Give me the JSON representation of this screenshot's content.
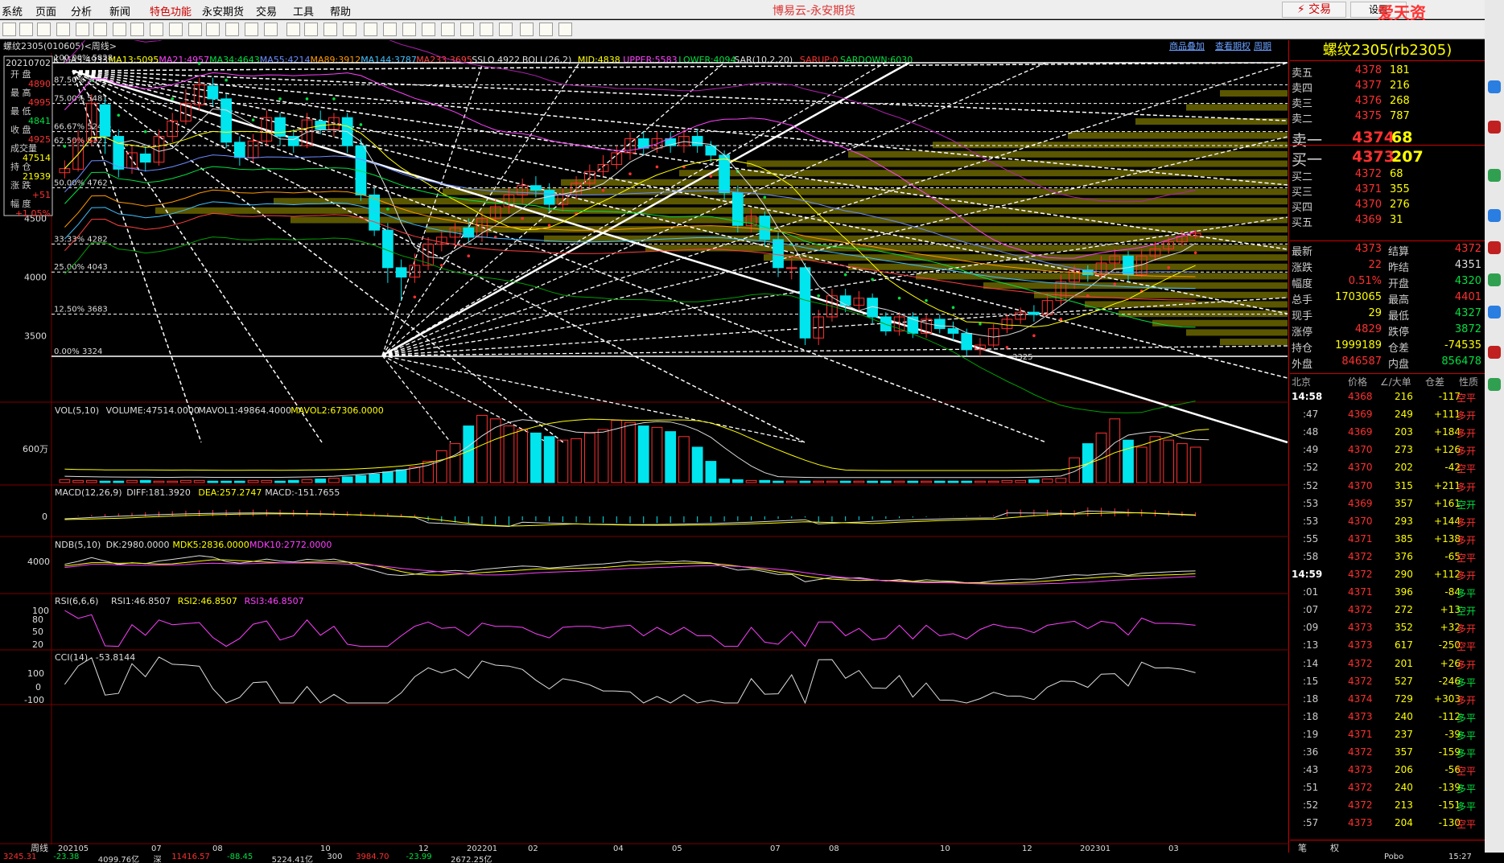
{
  "menu": [
    "系统",
    "页面",
    "分析",
    "新闻",
    "特色功能",
    "永安期货",
    "交易",
    "工具",
    "帮助"
  ],
  "app_title": "博易云-永安期货",
  "trade_button": "交易",
  "button2": "设置",
  "watermark": "爱天资5etz.com",
  "chart": {
    "instrument": "螺纹2305(010605)<周线>",
    "links": [
      "商品叠加",
      "查看期权",
      "周期"
    ],
    "ma_line": [
      {
        "t": "K",
        "c": "#ddd"
      },
      {
        "t": "MA5:4933",
        "c": "#ddd"
      },
      {
        "t": "MA13:5095",
        "c": "#ffff00"
      },
      {
        "t": "MA21:4957",
        "c": "#ff40ff"
      },
      {
        "t": "MA34:4643",
        "c": "#00e040"
      },
      {
        "t": "MA55:4214",
        "c": "#6a8cff"
      },
      {
        "t": "MA89:3912",
        "c": "#ff9900"
      },
      {
        "t": "MA144:3787",
        "c": "#40c0ff"
      },
      {
        "t": "MA233:3695",
        "c": "#ff4040"
      },
      {
        "t": "SSLO 4922",
        "c": "#ddd"
      },
      {
        "t": "BOLL(26,2)",
        "c": "#ddd"
      },
      {
        "t": "MID:4838",
        "c": "#ffff00"
      },
      {
        "t": "UPPER:5583",
        "c": "#ff40ff"
      },
      {
        "t": "LOWER:4094",
        "c": "#00e040"
      },
      {
        "t": "SAR(10,2,20)",
        "c": "#ddd"
      },
      {
        "t": "SARUP:0",
        "c": "#ff3030"
      },
      {
        "t": "SARDOWN:6030",
        "c": "#00e040"
      }
    ],
    "info_box": {
      "date": "20210702",
      "items": [
        {
          "label": "开 盘",
          "value": "4890",
          "color": "#ff3030"
        },
        {
          "label": "最 高",
          "value": "4995",
          "color": "#ff3030"
        },
        {
          "label": "最 低",
          "value": "4841",
          "color": "#00e040"
        },
        {
          "label": "收 盘",
          "value": "4925",
          "color": "#ff3030"
        },
        {
          "label": "成交量",
          "value": "47514",
          "color": "#ffff00"
        },
        {
          "label": "持 仓",
          "value": "21939",
          "color": "#ffff00"
        },
        {
          "label": "涨 跌",
          "value": "+51",
          "color": "#ff3030"
        },
        {
          "label": "幅 度",
          "value": "+1.05%",
          "color": "#ff3030"
        }
      ]
    },
    "yticks": [
      {
        "label": "4500",
        "y": 4500
      },
      {
        "label": "4000",
        "y": 4000
      },
      {
        "label": "3500",
        "y": 3500
      }
    ],
    "fib_levels": [
      {
        "pct": "100.00%",
        "val": "5828",
        "y": 5828
      },
      {
        "pct": "87.50%",
        "val": "5640",
        "y": 5640
      },
      {
        "pct": "75.00%",
        "val": "5481",
        "y": 5481
      },
      {
        "pct": "66.67%",
        "val": "5241",
        "y": 5241
      },
      {
        "pct": "62.50%",
        "val": "5121",
        "y": 5121
      },
      {
        "pct": "50.00%",
        "val": "4762",
        "y": 4762
      },
      {
        "pct": "33.33%",
        "val": "4282",
        "y": 4282
      },
      {
        "pct": "25.00%",
        "val": "4043",
        "y": 4043
      },
      {
        "pct": "12.50%",
        "val": "3683",
        "y": 3683
      },
      {
        "pct": "0.00%",
        "val": "3324",
        "y": 3324
      }
    ],
    "low_label": "3325",
    "xticks": [
      "202105",
      "07",
      "08",
      "10",
      "12",
      "202201",
      "02",
      "04",
      "05",
      "07",
      "08",
      "10",
      "12",
      "202301",
      "03"
    ],
    "period_label": "周线",
    "vol": {
      "title": "VOL(5,10)",
      "items": [
        {
          "t": "VOLUME:47514.0000",
          "c": "#ddd"
        },
        {
          "t": "MAVOL1:49864.4000",
          "c": "#ddd"
        },
        {
          "t": "MAVOL2:67306.0000",
          "c": "#ffff00"
        }
      ],
      "ytick": "600万"
    },
    "macd": {
      "title": "MACD(12,26,9)",
      "items": [
        {
          "t": "DIFF:181.3920",
          "c": "#ddd"
        },
        {
          "t": "DEA:257.2747",
          "c": "#ffff00"
        },
        {
          "t": "MACD:-151.7655",
          "c": "#ddd"
        }
      ],
      "ytick": "0"
    },
    "ndb": {
      "title": "NDB(5,10)",
      "items": [
        {
          "t": "DK:2980.0000",
          "c": "#ddd"
        },
        {
          "t": "MDK5:2836.0000",
          "c": "#ffff00"
        },
        {
          "t": "MDK10:2772.0000",
          "c": "#ff40ff"
        }
      ],
      "ytick": "4000"
    },
    "rsi": {
      "title": "RSI(6,6,6)",
      "items": [
        {
          "t": "RSI1:46.8507",
          "c": "#ddd"
        },
        {
          "t": "RSI2:46.8507",
          "c": "#ffff00"
        },
        {
          "t": "RSI3:46.8507",
          "c": "#ff40ff"
        }
      ],
      "yticks": [
        "100",
        "80",
        "50",
        "20"
      ]
    },
    "cci": {
      "title": "CCI(14)",
      "items": [
        {
          "t": "-53.8144",
          "c": "#ddd"
        }
      ],
      "yticks": [
        "100",
        "0",
        "-100"
      ]
    }
  },
  "quote": {
    "title": "螺纹2305(rb2305)",
    "asks": [
      {
        "label": "卖五",
        "price": "4378",
        "vol": "181"
      },
      {
        "label": "卖四",
        "price": "4377",
        "vol": "216"
      },
      {
        "label": "卖三",
        "price": "4376",
        "vol": "268"
      },
      {
        "label": "卖二",
        "price": "4375",
        "vol": "787"
      },
      {
        "label": "卖一",
        "price": "4374",
        "vol": "68"
      }
    ],
    "bids": [
      {
        "label": "买一",
        "price": "4373",
        "vol": "207"
      },
      {
        "label": "买二",
        "price": "4372",
        "vol": "68"
      },
      {
        "label": "买三",
        "price": "4371",
        "vol": "355"
      },
      {
        "label": "买四",
        "price": "4370",
        "vol": "276"
      },
      {
        "label": "买五",
        "price": "4369",
        "vol": "31"
      }
    ],
    "stats": [
      {
        "l": "最新",
        "v": "4373",
        "vc": "red",
        "l2": "结算",
        "v2": "4372",
        "v2c": "red"
      },
      {
        "l": "涨跌",
        "v": "22",
        "vc": "red",
        "l2": "昨结",
        "v2": "4351",
        "v2c": "white"
      },
      {
        "l": "幅度",
        "v": "0.51%",
        "vc": "red",
        "l2": "开盘",
        "v2": "4320",
        "v2c": "green"
      },
      {
        "l": "总手",
        "v": "1703065",
        "vc": "yellow",
        "l2": "最高",
        "v2": "4401",
        "v2c": "red"
      },
      {
        "l": "现手",
        "v": "29",
        "vc": "yellow",
        "l2": "最低",
        "v2": "4327",
        "v2c": "green"
      },
      {
        "l": "涨停",
        "v": "4829",
        "vc": "red",
        "l2": "跌停",
        "v2": "3872",
        "v2c": "green"
      },
      {
        "l": "持仓",
        "v": "1999189",
        "vc": "yellow",
        "l2": "仓差",
        "v2": "-74535",
        "v2c": "yellow"
      },
      {
        "l": "外盘",
        "v": "846587",
        "vc": "red",
        "l2": "内盘",
        "v2": "856478",
        "v2c": "green"
      }
    ],
    "ticks_header": [
      "北京",
      "价格",
      "∠/大单",
      "仓差",
      "性质"
    ],
    "ticks": [
      {
        "t": "14:58",
        "p": "4368",
        "v": "216",
        "d": "-117",
        "n": "空平",
        "nc": "red"
      },
      {
        "t": ":47",
        "p": "4369",
        "v": "249",
        "d": "+111",
        "n": "多开",
        "nc": "red"
      },
      {
        "t": ":48",
        "p": "4369",
        "v": "203",
        "d": "+184",
        "n": "多开",
        "nc": "red"
      },
      {
        "t": ":49",
        "p": "4370",
        "v": "273",
        "d": "+126",
        "n": "多开",
        "nc": "red"
      },
      {
        "t": ":52",
        "p": "4370",
        "v": "202",
        "d": "-42",
        "n": "空平",
        "nc": "red"
      },
      {
        "t": ":52",
        "p": "4370",
        "v": "315",
        "d": "+211",
        "n": "多开",
        "nc": "red"
      },
      {
        "t": ":53",
        "p": "4369",
        "v": "357",
        "d": "+161",
        "n": "空开",
        "nc": "green"
      },
      {
        "t": ":53",
        "p": "4370",
        "v": "293",
        "d": "+144",
        "n": "多开",
        "nc": "red"
      },
      {
        "t": ":55",
        "p": "4371",
        "v": "385",
        "d": "+138",
        "n": "多开",
        "nc": "red"
      },
      {
        "t": ":58",
        "p": "4372",
        "v": "376",
        "d": "-65",
        "n": "空平",
        "nc": "red"
      },
      {
        "t": "14:59",
        "p": "4372",
        "v": "290",
        "d": "+112",
        "n": "多开",
        "nc": "red"
      },
      {
        "t": ":01",
        "p": "4371",
        "v": "396",
        "d": "-84",
        "n": "多平",
        "nc": "green"
      },
      {
        "t": ":07",
        "p": "4372",
        "v": "272",
        "d": "+13",
        "n": "空开",
        "nc": "green"
      },
      {
        "t": ":09",
        "p": "4373",
        "v": "352",
        "d": "+32",
        "n": "多开",
        "nc": "red"
      },
      {
        "t": ":13",
        "p": "4373",
        "v": "617",
        "d": "-250",
        "n": "空平",
        "nc": "red"
      },
      {
        "t": ":14",
        "p": "4372",
        "v": "201",
        "d": "+26",
        "n": "多开",
        "nc": "red"
      },
      {
        "t": ":15",
        "p": "4372",
        "v": "527",
        "d": "-246",
        "n": "多平",
        "nc": "green"
      },
      {
        "t": ":18",
        "p": "4374",
        "v": "729",
        "d": "+303",
        "n": "多开",
        "nc": "red"
      },
      {
        "t": ":18",
        "p": "4373",
        "v": "240",
        "d": "-112",
        "n": "多平",
        "nc": "green"
      },
      {
        "t": ":19",
        "p": "4371",
        "v": "237",
        "d": "-39",
        "n": "多平",
        "nc": "green"
      },
      {
        "t": ":36",
        "p": "4372",
        "v": "357",
        "d": "-159",
        "n": "多平",
        "nc": "green"
      },
      {
        "t": ":43",
        "p": "4373",
        "v": "206",
        "d": "-56",
        "n": "空平",
        "nc": "red"
      },
      {
        "t": ":51",
        "p": "4372",
        "v": "240",
        "d": "-139",
        "n": "多平",
        "nc": "green"
      },
      {
        "t": ":52",
        "p": "4372",
        "v": "213",
        "d": "-151",
        "n": "多平",
        "nc": "green"
      },
      {
        "t": ":57",
        "p": "4373",
        "v": "204",
        "d": "-130",
        "n": "空平",
        "nc": "red"
      }
    ],
    "bottom_tabs": [
      "笔",
      "权"
    ]
  },
  "status": [
    {
      "t": "3245.31",
      "c": "#ff3030"
    },
    {
      "t": "-23.38",
      "c": "#00e040"
    },
    {
      "t": "4099.76亿",
      "c": "#ddd"
    },
    {
      "t": "深",
      "c": "#ddd"
    },
    {
      "t": "11416.57",
      "c": "#ff3030"
    },
    {
      "t": "-88.45",
      "c": "#00e040"
    },
    {
      "t": "5224.41亿",
      "c": "#ddd"
    },
    {
      "t": "300",
      "c": "#ddd"
    },
    {
      "t": "3984.70",
      "c": "#ff3030"
    },
    {
      "t": "-23.99",
      "c": "#00e040"
    },
    {
      "t": "2672.25亿",
      "c": "#ddd"
    }
  ],
  "status_right": [
    "Pobo",
    "15:27"
  ]
}
